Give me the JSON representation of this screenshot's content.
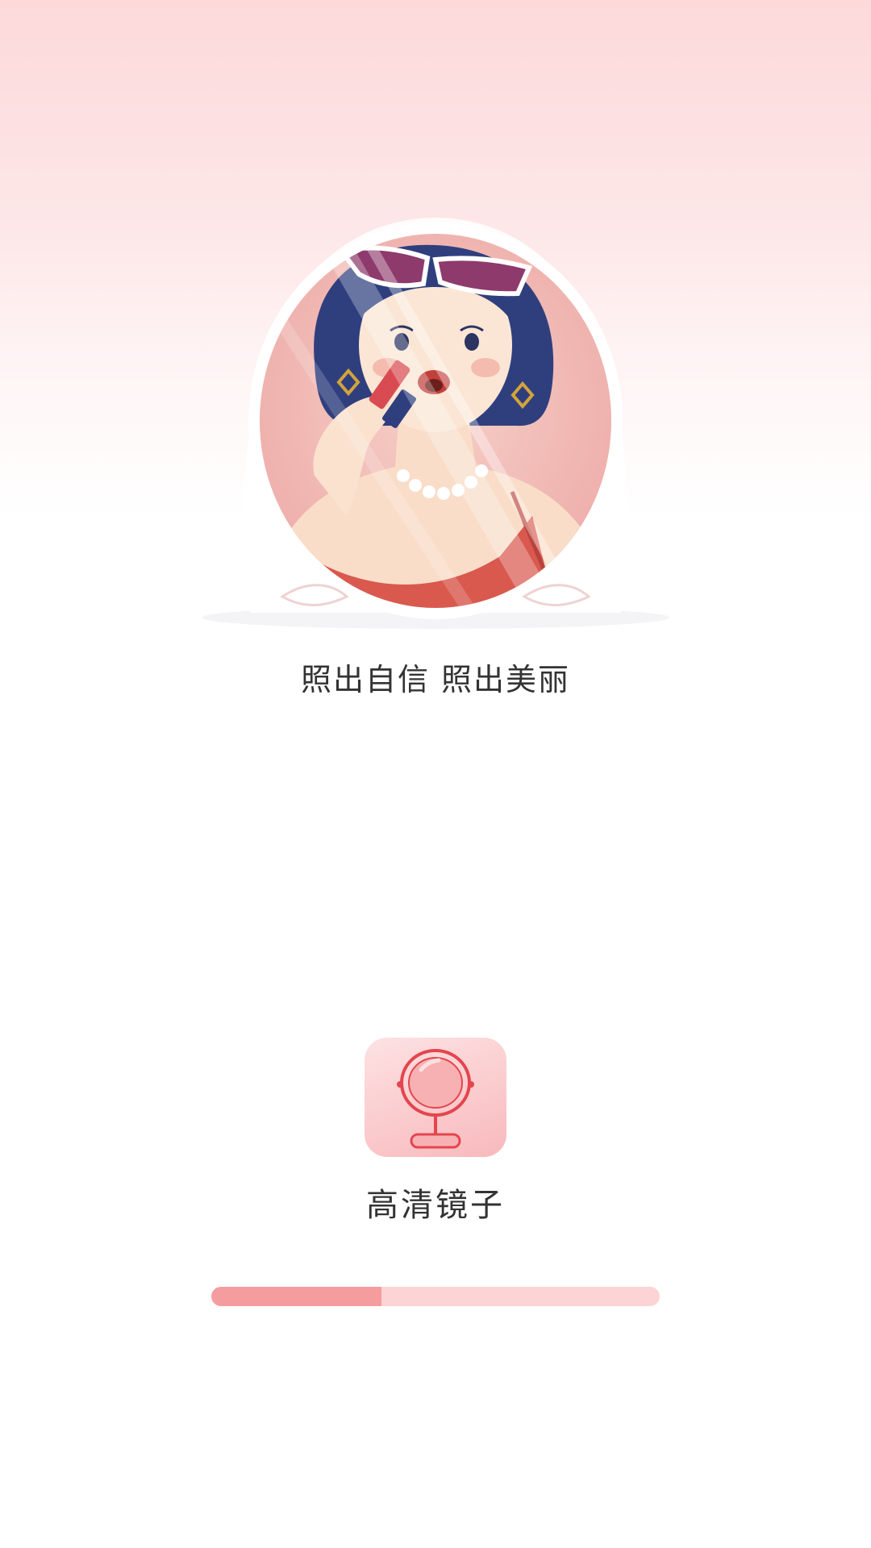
{
  "splash": {
    "tagline": "照出自信 照出美丽",
    "app_name": "高清镜子",
    "hero_illustration": "woman-applying-lipstick-in-round-mirror",
    "app_icon": "vanity-mirror-icon"
  },
  "progress": {
    "value": 0.38
  },
  "colors": {
    "top_gradient": "#fdd9da",
    "progress_fill": "#f59c9e",
    "progress_track": "#fdd4d5",
    "icon_tile_light": "#fde2e3",
    "icon_tile_dark": "#f8b9bc",
    "icon_stroke": "#e4454e",
    "text": "#333333"
  }
}
